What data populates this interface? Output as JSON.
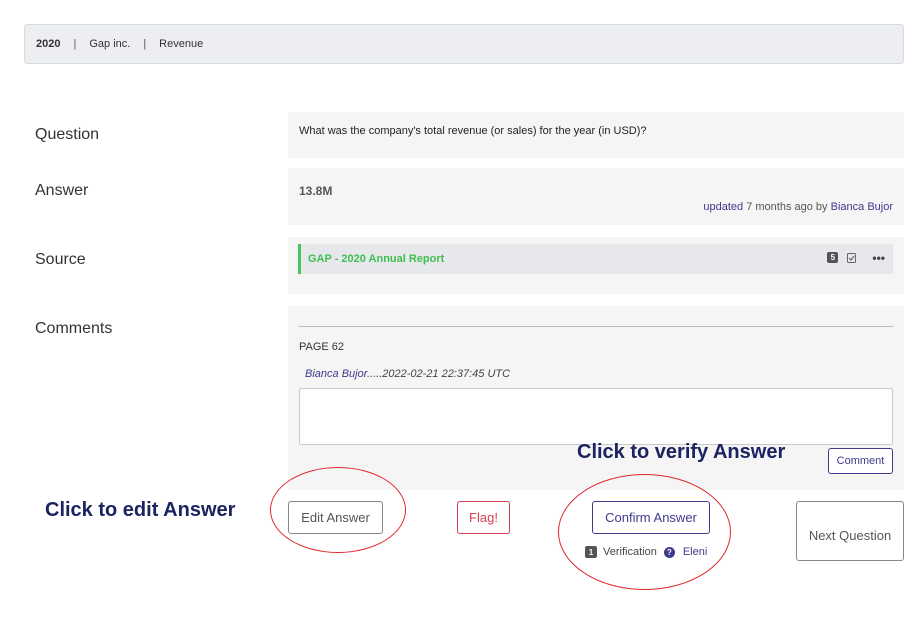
{
  "header": {
    "year": "2020",
    "company": "Gap inc.",
    "metric": "Revenue",
    "separator": "|"
  },
  "labels": {
    "question": "Question",
    "answer": "Answer",
    "source": "Source",
    "comments": "Comments"
  },
  "question": {
    "text": "What was the company's total revenue (or sales) for the year (in USD)?"
  },
  "answer": {
    "value": "13.8M",
    "updated_prefix": "updated",
    "updated_time": "7 months ago by",
    "updated_by": "Bianca Bujor"
  },
  "source": {
    "link_text": "GAP - 2020 Annual Report",
    "count_badge": "5",
    "more_label": "•••"
  },
  "comments": {
    "page_ref": "PAGE 62",
    "author": "Bianca Bujor",
    "timestamp": ".....2022-02-21 22:37:45 UTC",
    "input_value": "",
    "submit_label": "Comment"
  },
  "actions": {
    "edit_label": "Edit Answer",
    "flag_label": "Flag!",
    "confirm_label": "Confirm Answer",
    "next_label": "Next Question"
  },
  "verification": {
    "count": "1",
    "label": "Verification",
    "help_icon": "?",
    "verifier": "Eleni"
  },
  "annotations": {
    "edit_hint": "Click to edit Answer",
    "verify_hint": "Click to verify Answer"
  },
  "colors": {
    "accent": "#3f3a8c",
    "source_green": "#3fbf4f",
    "flag_red": "#d43f52",
    "highlight_red": "#e0282e",
    "annotation_navy": "#1c2361"
  }
}
